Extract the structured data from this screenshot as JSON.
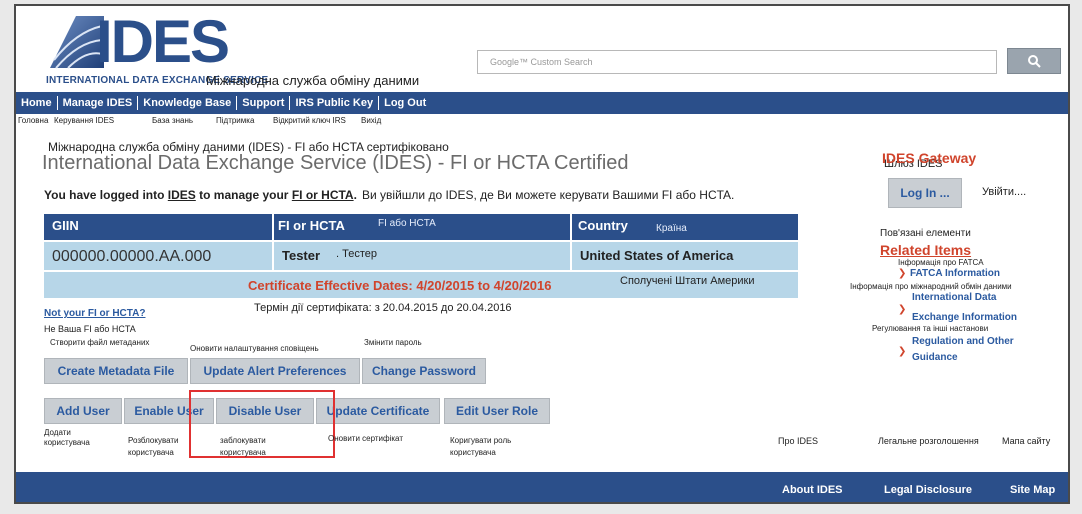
{
  "logo": {
    "letters": "IDES",
    "subtitle": "INTERNATIONAL DATA EXCHANGE SERVICE",
    "subtitle_uk": "Міжнародна служба обміну даними"
  },
  "search": {
    "placeholder": "Google™ Custom Search"
  },
  "nav": {
    "items": [
      "Home",
      "Manage IDES",
      "Knowledge Base",
      "Support",
      "IRS Public Key",
      "Log Out"
    ],
    "items_uk": [
      "Головна",
      "Керування IDES",
      "База знань",
      "Підтримка",
      "Відкритий ключ IRS",
      "Вихід"
    ]
  },
  "header": {
    "subtitle_uk": "Міжнародна служба обміну даними (IDES) - FI або HCTA сертифіковано",
    "title": "International Data Exchange Service (IDES) - FI or HCTA Certified",
    "logged_in_prefix": "You have logged into ",
    "logged_in_ides": "IDES",
    "logged_in_mid": " to manage your ",
    "logged_in_fi": "FI or HCTA",
    "logged_in_end": ".",
    "logged_in_uk": "Ви увійшли до IDES, де Ви можете керувати Вашими FI або HCTA."
  },
  "table": {
    "col_giin": "GIIN",
    "col_fi": "FI or HCTA",
    "col_fi_uk": "FI або HCTA",
    "col_country": "Country",
    "col_country_uk": "Країна",
    "giin": "000000.00000.AA.000",
    "fi": "Tester",
    "fi_uk": ". Тестер",
    "country": "United States of America",
    "country_uk": "Сполучені Штати Америки",
    "cert_dates": "Certificate Effective Dates: 4/20/2015 to 4/20/2016",
    "cert_dates_uk": "Термін дії сертифіката: з 20.04.2015 до 20.04.2016"
  },
  "not_your": {
    "link": "Not your FI or HCTA?",
    "uk": "Не Ваша FI або HCTA"
  },
  "buttons_row1": {
    "create_metadata": "Create Metadata File",
    "create_metadata_uk": "Створити файл метаданих",
    "update_alert": "Update Alert Preferences",
    "update_alert_uk": "Оновити налаштування сповіщень",
    "change_password": "Change Password",
    "change_password_uk": "Змінити пароль"
  },
  "buttons_row2": {
    "add_user": "Add User",
    "add_user_uk_1": "Додати",
    "add_user_uk_2": "користувача",
    "enable_user": "Enable User",
    "enable_user_uk_1": "Розблокувати",
    "enable_user_uk_2": "користувача",
    "disable_user": "Disable User",
    "disable_user_uk_1": "заблокувати",
    "disable_user_uk_2": "користувача",
    "update_cert": "Update Certificate",
    "update_cert_uk": "Оновити сертифікат",
    "edit_role": "Edit User Role",
    "edit_role_uk_1": "Коригувати роль",
    "edit_role_uk_2": "користувача"
  },
  "gateway": {
    "label_uk": "Шлюз IDES",
    "title": "IDES Gateway",
    "login": "Log In ...",
    "login_uk": "Увійти...."
  },
  "related": {
    "label_uk": "Пов'язані елементи",
    "title": "Related Items",
    "fatca_uk": "Інформація про FATCA",
    "fatca": "FATCA Information",
    "ides_info_uk": "Інформація про міжнародний обмін даними",
    "ides_info_1": "International Data",
    "ides_info_2": "Exchange Information",
    "reg_uk": "Регулювання та інші настанови",
    "reg_1": "Regulation and Other",
    "reg_2": "Guidance"
  },
  "footer": {
    "about": "About IDES",
    "about_uk": "Про IDES",
    "legal": "Legal Disclosure",
    "legal_uk": "Легальне розголошення",
    "sitemap": "Site Map",
    "sitemap_uk": "Мапа сайту"
  },
  "colors": {
    "brand": "#2b4f8a",
    "cert_red": "#d0442c",
    "highlight": "#e03131"
  }
}
